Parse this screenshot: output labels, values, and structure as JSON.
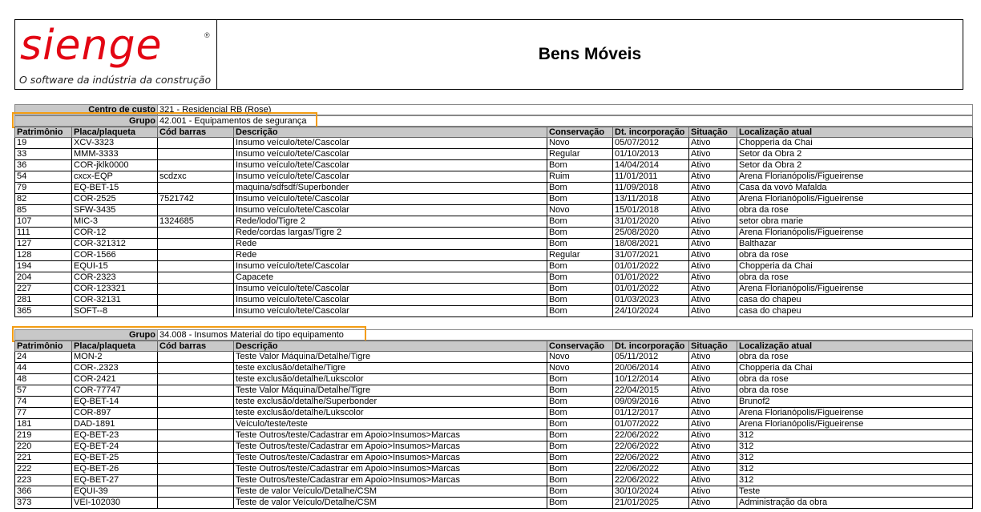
{
  "header": {
    "logo_text": "sienge",
    "logo_reg": "®",
    "logo_slogan": "O software da indústria da construção",
    "title": "Bens Móveis"
  },
  "centro_custo": {
    "label": "Centro de custo",
    "value": "321 - Residencial RB (Rose)"
  },
  "columns": [
    "Patrimônio",
    "Placa/plaqueta",
    "Cód barras",
    "Descrição",
    "Conservação",
    "Dt. incorporação",
    "Situação",
    "Localização atual"
  ],
  "groups": [
    {
      "label": "Grupo",
      "value": "42.001 - Equipamentos de segurança",
      "rows": [
        [
          "19",
          "XCV-3323",
          "",
          "Insumo veículo/tete/Cascolar",
          "Novo",
          "05/07/2012",
          "Ativo",
          "Chopperia da Chai"
        ],
        [
          "33",
          "MMM-3333",
          "",
          "Insumo veículo/tete/Cascolar",
          "Regular",
          "01/10/2013",
          "Ativo",
          "Setor da Obra 2"
        ],
        [
          "36",
          "COR-jklk0000",
          "",
          "Insumo veículo/tete/Cascolar",
          "Bom",
          "14/04/2014",
          "Ativo",
          "Setor da Obra 2"
        ],
        [
          "54",
          "cxcx-EQP",
          "scdzxc",
          "Insumo veículo/tete/Cascolar",
          "Ruim",
          "11/01/2011",
          "Ativo",
          "Arena Florianópolis/Figueirense"
        ],
        [
          "79",
          "EQ-BET-15",
          "",
          "maquina/sdfsdf/Superbonder",
          "Bom",
          "11/09/2018",
          "Ativo",
          "Casa da vovó Mafalda"
        ],
        [
          "82",
          "COR-2525",
          "7521742",
          "Insumo veículo/tete/Cascolar",
          "Bom",
          "13/11/2018",
          "Ativo",
          "Arena Florianópolis/Figueirense"
        ],
        [
          "85",
          "SFW-3435",
          "",
          "Insumo veículo/tete/Cascolar",
          "Novo",
          "15/01/2018",
          "Ativo",
          "obra da rose"
        ],
        [
          "107",
          "MIC-3",
          "1324685",
          "Rede/lodo/Tigre 2",
          "Bom",
          "31/01/2020",
          "Ativo",
          "setor obra marie"
        ],
        [
          "111",
          "COR-12",
          "",
          "Rede/cordas largas/Tigre 2",
          "Bom",
          "25/08/2020",
          "Ativo",
          "Arena Florianópolis/Figueirense"
        ],
        [
          "127",
          "COR-321312",
          "",
          "Rede",
          "Bom",
          "18/08/2021",
          "Ativo",
          "Balthazar"
        ],
        [
          "128",
          "COR-1566",
          "",
          "Rede",
          "Regular",
          "31/07/2021",
          "Ativo",
          "obra da rose"
        ],
        [
          "194",
          "EQUI-15",
          "",
          "Insumo veículo/tete/Cascolar",
          "Bom",
          "01/01/2022",
          "Ativo",
          "Chopperia da Chai"
        ],
        [
          "204",
          "COR-2323",
          "",
          "Capacete",
          "Bom",
          "01/01/2022",
          "Ativo",
          "obra da rose"
        ],
        [
          "227",
          "COR-123321",
          "",
          "Insumo veículo/tete/Cascolar",
          "Bom",
          "01/01/2022",
          "Ativo",
          "Arena Florianópolis/Figueirense"
        ],
        [
          "281",
          "COR-32131",
          "",
          "Insumo veículo/tete/Cascolar",
          "Bom",
          "01/03/2023",
          "Ativo",
          "casa do chapeu"
        ],
        [
          "365",
          "SOFT--8",
          "",
          "Insumo veículo/tete/Cascolar",
          "Bom",
          "24/10/2024",
          "Ativo",
          "casa do chapeu"
        ]
      ]
    },
    {
      "label": "Grupo",
      "value": "34.008 - Insumos Material do tipo equipamento",
      "rows": [
        [
          "24",
          "MON-2",
          "",
          "Teste Valor Máquina/Detalhe/Tigre",
          "Novo",
          "05/11/2012",
          "Ativo",
          "obra da rose"
        ],
        [
          "44",
          "COR-.2323",
          "",
          "teste exclusão/detalhe/Tigre",
          "Novo",
          "20/06/2014",
          "Ativo",
          "Chopperia da Chai"
        ],
        [
          "48",
          "COR-2421",
          "",
          "teste exclusão/detalhe/Lukscolor",
          "Bom",
          "10/12/2014",
          "Ativo",
          "obra da rose"
        ],
        [
          "57",
          "COR-77747",
          "",
          "Teste Valor Máquina/Detalhe/Tigre",
          "Bom",
          "22/04/2015",
          "Ativo",
          "obra da rose"
        ],
        [
          "74",
          "EQ-BET-14",
          "",
          "teste exclusão/detalhe/Superbonder",
          "Bom",
          "09/09/2016",
          "Ativo",
          "Brunof2"
        ],
        [
          "77",
          "COR-897",
          "",
          "teste exclusão/detalhe/Lukscolor",
          "Bom",
          "01/12/2017",
          "Ativo",
          "Arena Florianópolis/Figueirense"
        ],
        [
          "181",
          "DAD-1891",
          "",
          "Veículo/teste/teste",
          "Bom",
          "01/07/2022",
          "Ativo",
          "Arena Florianópolis/Figueirense"
        ],
        [
          "219",
          "EQ-BET-23",
          "",
          "Teste Outros/teste/Cadastrar em Apoio>Insumos>Marcas",
          "Bom",
          "22/06/2022",
          "Ativo",
          "312"
        ],
        [
          "220",
          "EQ-BET-24",
          "",
          "Teste Outros/teste/Cadastrar em Apoio>Insumos>Marcas",
          "Bom",
          "22/06/2022",
          "Ativo",
          "312"
        ],
        [
          "221",
          "EQ-BET-25",
          "",
          "Teste Outros/teste/Cadastrar em Apoio>Insumos>Marcas",
          "Bom",
          "22/06/2022",
          "Ativo",
          "312"
        ],
        [
          "222",
          "EQ-BET-26",
          "",
          "Teste Outros/teste/Cadastrar em Apoio>Insumos>Marcas",
          "Bom",
          "22/06/2022",
          "Ativo",
          "312"
        ],
        [
          "223",
          "EQ-BET-27",
          "",
          "Teste Outros/teste/Cadastrar em Apoio>Insumos>Marcas",
          "Bom",
          "22/06/2022",
          "Ativo",
          "312"
        ],
        [
          "366",
          "EQUI-39",
          "",
          "Teste de valor Veículo/Detalhe/CSM",
          "Bom",
          "30/10/2024",
          "Ativo",
          "Teste"
        ],
        [
          "373",
          "VEI-102030",
          "",
          "Teste de valor Veículo/Detalhe/CSM",
          "Bom",
          "21/01/2025",
          "Ativo",
          "Administração da obra"
        ]
      ]
    }
  ],
  "colors": {
    "highlight": "#f39c12",
    "logo_red": "#e30613",
    "header_gray": "#c8c8c8"
  }
}
